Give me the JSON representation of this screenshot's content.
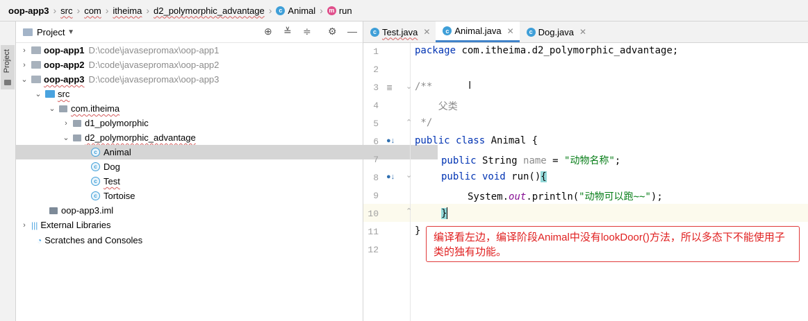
{
  "breadcrumb": {
    "items": [
      "oop-app3",
      "src",
      "com",
      "itheima",
      "d2_polymorphic_advantage",
      "Animal",
      "run"
    ]
  },
  "sidestripe": {
    "label": "Project"
  },
  "project_panel": {
    "title": "Project",
    "tree": [
      {
        "label": "oop-app1",
        "path": "D:\\code\\javasepromax\\oop-app1"
      },
      {
        "label": "oop-app2",
        "path": "D:\\code\\javasepromax\\oop-app2"
      },
      {
        "label": "oop-app3",
        "path": "D:\\code\\javasepromax\\oop-app3"
      },
      {
        "label": "src"
      },
      {
        "label": "com.itheima"
      },
      {
        "label": "d1_polymorphic"
      },
      {
        "label": "d2_polymorphic_advantage"
      },
      {
        "label": "Animal"
      },
      {
        "label": "Dog"
      },
      {
        "label": "Test"
      },
      {
        "label": "Tortoise"
      },
      {
        "label": "oop-app3.iml"
      },
      {
        "label": "External Libraries"
      },
      {
        "label": "Scratches and Consoles"
      }
    ]
  },
  "editor_tabs": [
    "Test.java",
    "Animal.java",
    "Dog.java"
  ],
  "editor": {
    "line_numbers": [
      "1",
      "2",
      "3",
      "4",
      "5",
      "6",
      "7",
      "8",
      "9",
      "10",
      "11",
      "12"
    ],
    "lines": {
      "l1_kw": "package",
      "l1_rest": " com.itheima.d2_polymorphic_advantage;",
      "l3": "/**",
      "l4": "    父类",
      "l5": " */",
      "l6_kw": "public class",
      "l6_rest": " Animal {",
      "l7_kw": "public",
      "l7_type": " String ",
      "l7_field": "name",
      "l7_eq": " = ",
      "l7_str": "\"动物名称\"",
      "l7_end": ";",
      "l8_kw": "public void",
      "l8_rest": " run()",
      "l8_brace": "{",
      "l9_a": "System.",
      "l9_out": "out",
      "l9_b": ".println(",
      "l9_str": "\"动物可以跑~~\"",
      "l9_c": ");",
      "l10": "}",
      "l11": "}"
    }
  },
  "annotation": {
    "text": "编译看左边，编译阶段Animal中没有lookDoor()方法，所以多态下不能使用子类的独有功能。"
  },
  "colors": {
    "accent": "#4083c9",
    "note_border": "#e03a3a",
    "note_text": "#e02020"
  }
}
